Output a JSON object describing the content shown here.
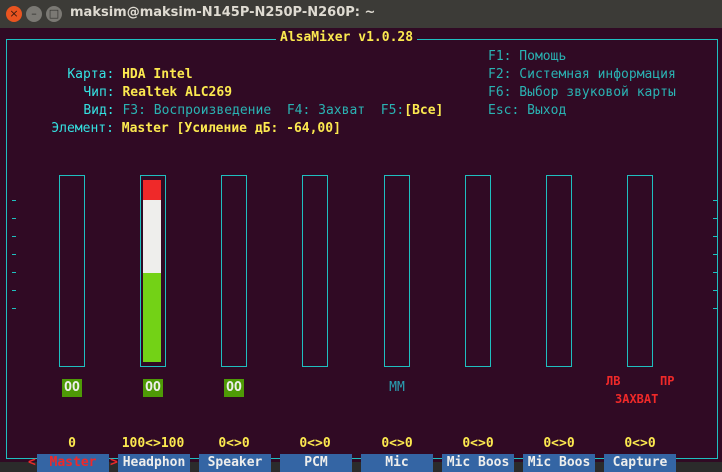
{
  "window": {
    "title": "maksim@maksim-N145P-N250P-N260P: ~"
  },
  "mixer": {
    "title": "AlsaMixer v1.0.28",
    "card_label": "Карта:",
    "card_value": "HDA Intel",
    "chip_label": "Чип:",
    "chip_value": "Realtek ALC269",
    "view_label": "Вид:",
    "view_f3": "F3: Воспроизведение",
    "view_f4": "F4: Захват",
    "view_f5_key": "F5:",
    "view_f5_value": "[Все]",
    "element_label": "Элемент:",
    "element_value": "Master [Усиление дБ: -64,00]",
    "help": [
      "F1: Помощь",
      "F2: Системная информация",
      "F6: Выбор звуковой карты",
      "Esc: Выход"
    ]
  },
  "channels": [
    {
      "name": "Master",
      "volume": "0",
      "level_percent": 0,
      "mute": "OO",
      "selected": true
    },
    {
      "name": "Headphon",
      "volume": "100<>100",
      "level_percent": 100,
      "mute": "OO",
      "selected": false
    },
    {
      "name": "Speaker",
      "volume": "0<>0",
      "level_percent": 0,
      "mute": "OO",
      "selected": false
    },
    {
      "name": "PCM",
      "volume": "0<>0",
      "level_percent": 0,
      "mute": "",
      "selected": false
    },
    {
      "name": "Mic",
      "volume": "0<>0",
      "level_percent": 0,
      "mute": "MM",
      "selected": false
    },
    {
      "name": "Mic Boos",
      "volume": "0<>0",
      "level_percent": 0,
      "mute": "",
      "selected": false
    },
    {
      "name": "Mic Boos",
      "volume": "0<>0",
      "level_percent": 0,
      "mute": "",
      "selected": false
    },
    {
      "name": "Capture",
      "volume": "0<>0",
      "level_percent": 0,
      "mute": "",
      "selected": false
    }
  ],
  "capture": {
    "left": "ЛВ",
    "right": "ПР",
    "label": "ЗАХВАТ"
  },
  "selection_arrows": {
    "left": "<",
    "right": ">"
  },
  "colors": {
    "terminal_bg": "#300a24",
    "frame": "#1fbfbf",
    "highlight": "#fce94f",
    "label_bg": "#3465a4",
    "level_green": "#73d216",
    "level_white": "#eeeeec",
    "level_red": "#ef2929"
  }
}
